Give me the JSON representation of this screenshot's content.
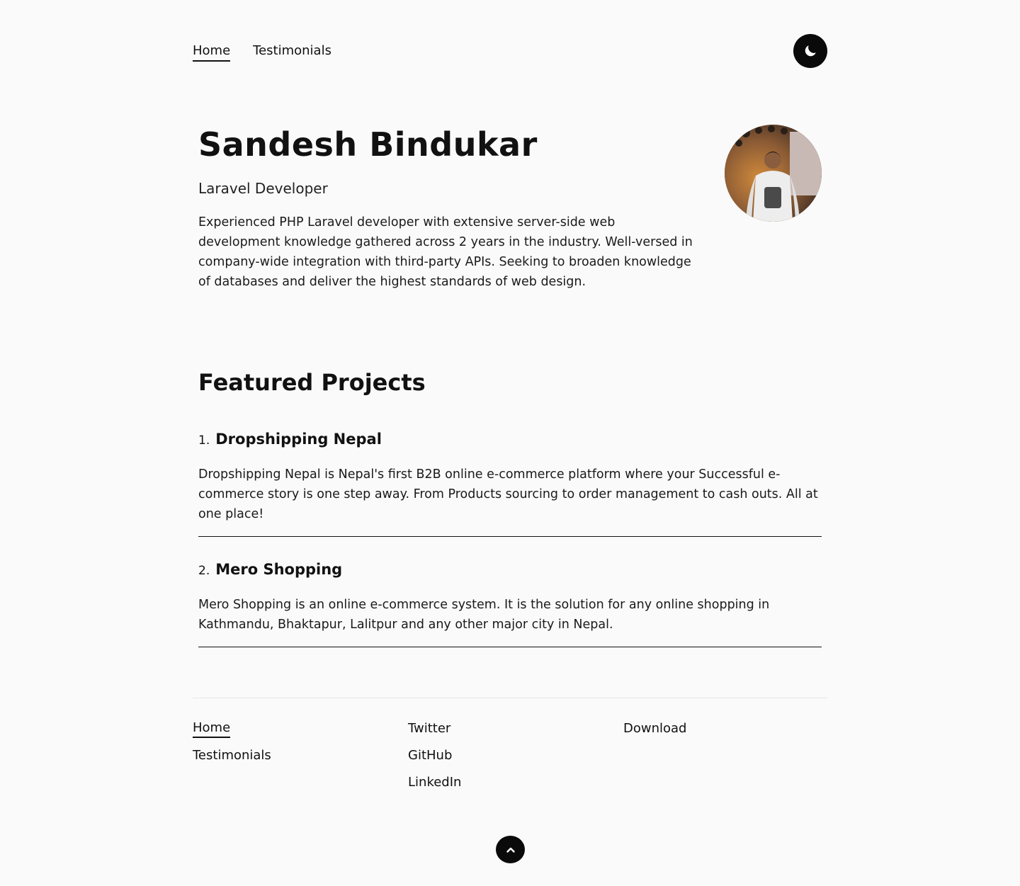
{
  "nav": {
    "items": [
      {
        "label": "Home",
        "active": true
      },
      {
        "label": "Testimonials",
        "active": false
      }
    ],
    "theme_toggle_icon": "moon-icon"
  },
  "hero": {
    "name": "Sandesh Bindukar",
    "role": "Laravel Developer",
    "bio": "Experienced PHP Laravel developer with extensive server-side web development knowledge gathered across 2 years in the industry. Well-versed in company-wide integration with third-party APIs. Seeking to broaden knowledge of databases and deliver the highest standards of web design.",
    "avatar": "avatar-photo"
  },
  "projects": {
    "title": "Featured Projects",
    "items": [
      {
        "number": "1.",
        "name": "Dropshipping Nepal",
        "description": "Dropshipping Nepal is Nepal's first B2B online e-commerce platform where your Successful e-commerce story is one step away. From Products sourcing to order management to cash outs. All at one place!"
      },
      {
        "number": "2.",
        "name": "Mero Shopping",
        "description": "Mero Shopping is an online e-commerce system. It is the solution for any online shopping in Kathmandu, Bhaktapur, Lalitpur and any other major city in Nepal."
      }
    ]
  },
  "footer": {
    "pages": [
      "Home",
      "Testimonials"
    ],
    "social": [
      "Twitter",
      "GitHub",
      "LinkedIn"
    ],
    "extra": [
      "Download"
    ],
    "back_to_top_icon": "chevron-up-icon"
  },
  "colors": {
    "background": "#fafafa",
    "text": "#111111",
    "accent": "#0a0a0a"
  }
}
